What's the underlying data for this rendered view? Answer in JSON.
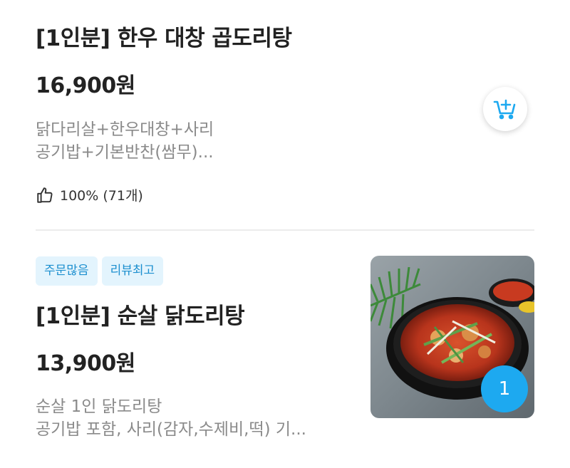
{
  "items": [
    {
      "title": "[1인분] 한우 대창 곱도리탕",
      "price": "16,900원",
      "desc_line1": "닭다리살+한우대창+사리",
      "desc_line2": "공기밥+기본반찬(쌈무)...",
      "rating": "100% (71개)",
      "cart_icon": "add-to-cart-icon"
    },
    {
      "badges": [
        "주문많음",
        "리뷰최고"
      ],
      "title": "[1인분] 순살 닭도리탕",
      "price": "13,900원",
      "desc_line1": "순살 1인 닭도리탕",
      "desc_line2": "공기밥 포함, 사리(감자,수제비,떡) 기...",
      "quantity": "1"
    }
  ],
  "colors": {
    "accent": "#1da9f0",
    "badge_bg": "#e3f4fd",
    "badge_text": "#1c8fcf",
    "muted_text": "#8a8a8a"
  }
}
